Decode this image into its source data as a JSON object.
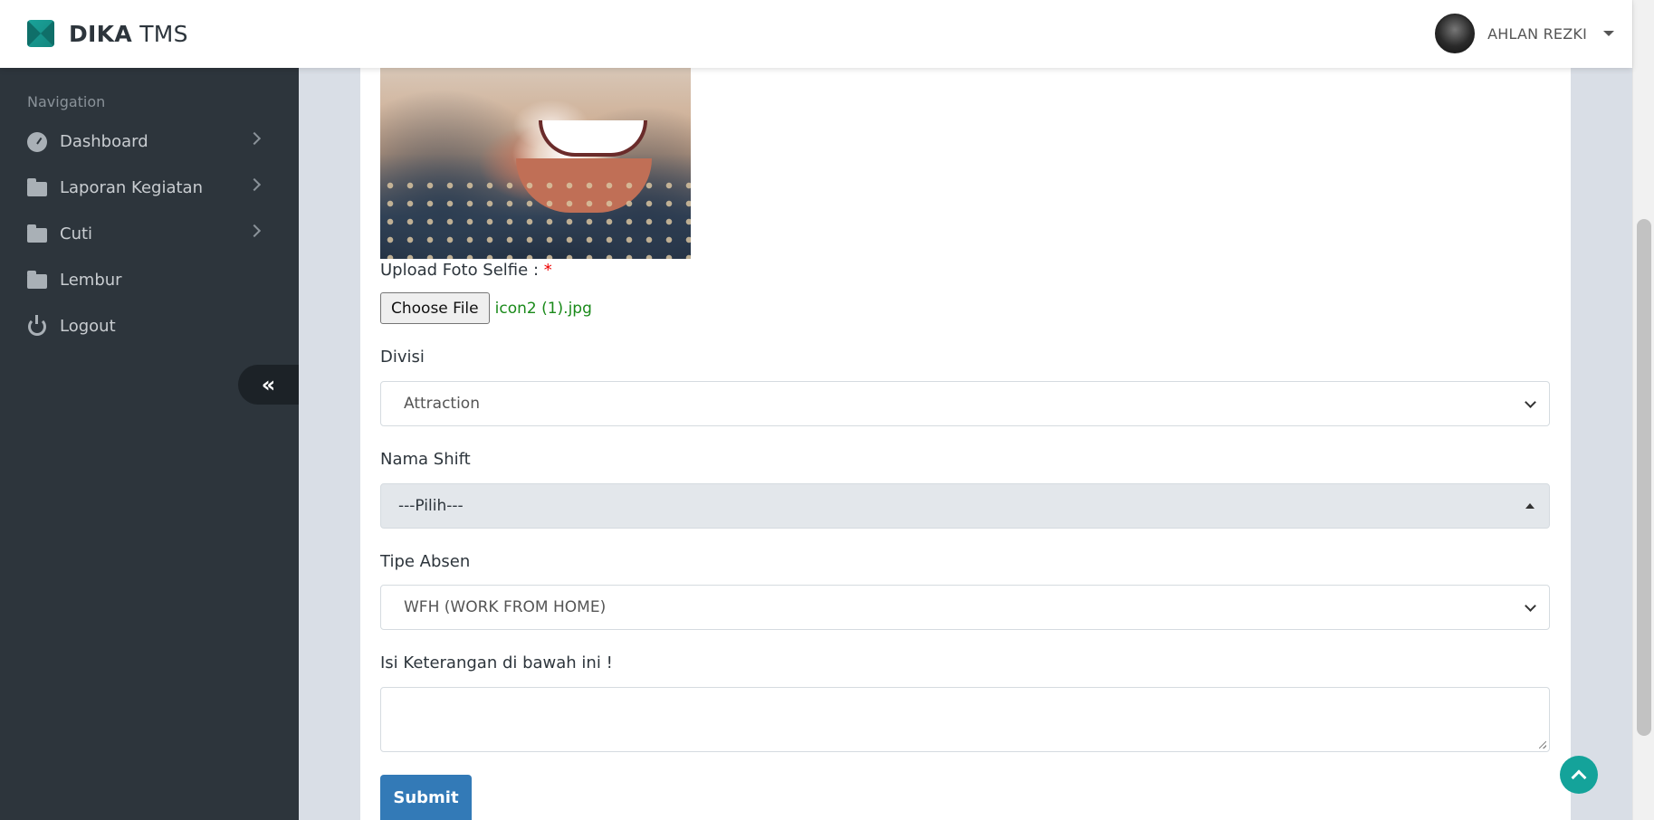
{
  "header": {
    "brand_bold": "DIKA",
    "brand_light": "TMS",
    "user_name": "AHLAN REZKI"
  },
  "sidebar": {
    "nav_header": "Navigation",
    "items": [
      {
        "label": "Dashboard",
        "icon": "dashboard-icon",
        "has_submenu": true
      },
      {
        "label": "Laporan Kegiatan",
        "icon": "folder-icon",
        "has_submenu": true
      },
      {
        "label": "Cuti",
        "icon": "folder-icon",
        "has_submenu": true
      },
      {
        "label": "Lembur",
        "icon": "folder-icon",
        "has_submenu": false
      },
      {
        "label": "Logout",
        "icon": "power-icon",
        "has_submenu": false
      }
    ],
    "collapse_icon": "«"
  },
  "form": {
    "upload_label": "Upload Foto Selfie :",
    "required_mark": "*",
    "choose_file_label": "Choose File",
    "file_name": "icon2 (1).jpg",
    "divisi_label": "Divisi",
    "divisi_value": "Attraction",
    "shift_label": "Nama Shift",
    "shift_value": "---Pilih---",
    "tipe_label": "Tipe Absen",
    "tipe_value": "WFH (WORK FROM HOME)",
    "keterangan_label": "Isi Keterangan di bawah ini !",
    "keterangan_value": "",
    "submit_label": "Submit"
  },
  "colors": {
    "sidebar_bg": "#2d353c",
    "accent_teal": "#14a39a",
    "submit_blue": "#337ab7",
    "file_name_green": "#1a8a1a",
    "required_red": "#ee0000"
  }
}
